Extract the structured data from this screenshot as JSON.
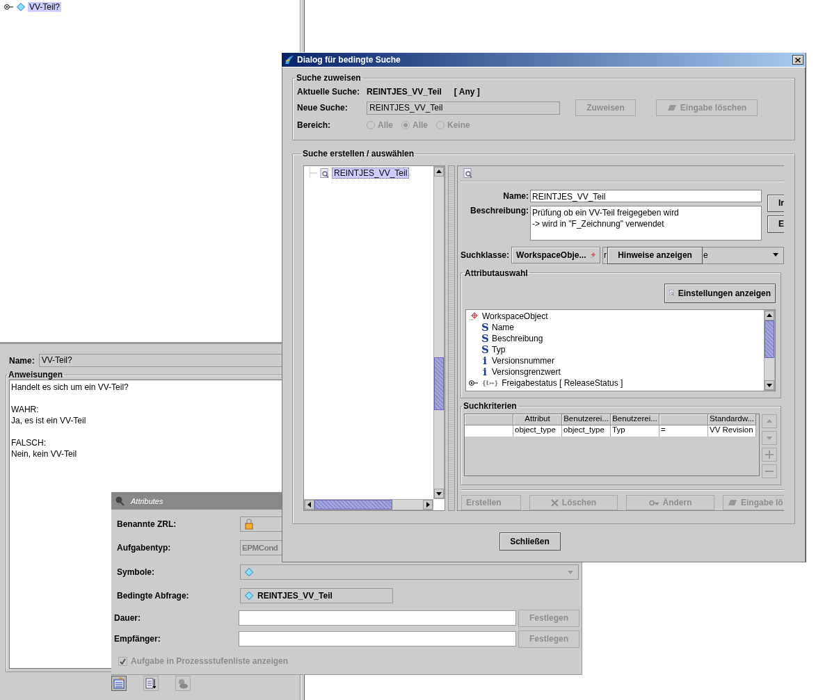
{
  "main_tree": {
    "items": [
      {
        "label": "VV-Teil?",
        "selected": true,
        "expanded": false
      }
    ]
  },
  "properties": {
    "name_label": "Name:",
    "name_value": "VV-Teil?",
    "instructions_title": "Anweisungen",
    "instructions_text": "Handelt es sich um ein VV-Teil?\n\nWAHR:\nJa, es ist ein VV-Teil\n\nFALSCH:\nNein, kein VV-Teil"
  },
  "attributes_window": {
    "title": "Attributes",
    "rows": [
      {
        "kind": "lock",
        "label": "Benannte ZRL:"
      },
      {
        "kind": "readonly",
        "label": "Aufgabentyp:",
        "value": "EPMCond"
      },
      {
        "kind": "combo",
        "label": "Symbole:"
      },
      {
        "kind": "query",
        "label": "Bedingte Abfrage:",
        "value": "REINTJES_VV_Teil"
      },
      {
        "kind": "input",
        "label": "Dauer:",
        "button": "Festlegen",
        "button_disabled": true
      },
      {
        "kind": "input",
        "label": "Empfänger:",
        "button": "Festlegen",
        "button_disabled": true
      }
    ],
    "checkbox": {
      "label": "Aufgabe in Prozessstufenliste anzeigen",
      "checked": true,
      "disabled": true
    }
  },
  "dialog": {
    "title": "Dialog für bedingte Suche",
    "assign_group": {
      "title": "Suche zuweisen",
      "current_label": "Aktuelle Suche:",
      "current_value": "REINTJES_VV_Teil",
      "current_scope": "[ Any ]",
      "new_label": "Neue Suche:",
      "new_value": "REINTJES_VV_Teil",
      "buttons": [
        {
          "kind": "plain",
          "label": "Zuweisen",
          "disabled": true
        },
        {
          "kind": "eraser",
          "label": "Eingabe löschen",
          "disabled": true
        }
      ],
      "scope_label": "Bereich:",
      "scope_options": [
        {
          "label": "Alle",
          "selected": false,
          "disabled": true
        },
        {
          "label": "Alle",
          "selected": true,
          "disabled": true
        },
        {
          "label": "Keine",
          "selected": false,
          "disabled": true
        }
      ]
    },
    "build_group": {
      "title": "Suche erstellen / auswählen",
      "search_tree": {
        "items": [
          {
            "label": "REINTJES_VV_Teil",
            "selected": true
          }
        ]
      },
      "editor": {
        "name_label": "Name:",
        "name_value": "REINTJES_VV_Teil",
        "description_label": "Beschreibung:",
        "description_value": "Prüfung ob ein VV-Teil freigegeben wird\n-> wird in \"F_Zeichnung\" verwendet",
        "side_buttons": [
          "Ir",
          "E"
        ],
        "class_label": "Suchklasse:",
        "class_value": "WorkspaceObje...",
        "class_dropdown_fragments": [
          "r",
          "e"
        ],
        "hints_button": "Hinweise anzeigen",
        "attribute_group": {
          "title": "Attributauswahl",
          "settings_button": "Einstellungen anzeigen",
          "tree": [
            {
              "kind": "class",
              "label": "WorkspaceObject",
              "children": [
                {
                  "kind": "attribute",
                  "glyph": "S",
                  "label": "Name"
                },
                {
                  "kind": "attribute",
                  "glyph": "S",
                  "label": "Beschreibung"
                },
                {
                  "kind": "attribute",
                  "glyph": "S",
                  "label": "Typ"
                },
                {
                  "kind": "attribute",
                  "glyph": "i",
                  "label": "Versionsnummer"
                },
                {
                  "kind": "attribute",
                  "glyph": "i",
                  "label": "Versionsgrenzwert"
                },
                {
                  "kind": "reference",
                  "glyph": "{t↔}",
                  "label": "Freigabestatus [ ReleaseStatus ]",
                  "expanded": false
                }
              ]
            }
          ]
        },
        "criteria_group": {
          "title": "Suchkriterien",
          "columns": [
            {
              "kind": "blank"
            },
            {
              "kind": "text",
              "label": "Attribut"
            },
            {
              "kind": "text",
              "label": "Benutzerei..."
            },
            {
              "kind": "text",
              "label": "Benutzerei..."
            },
            {
              "kind": "blank"
            },
            {
              "kind": "text",
              "label": "Standardw..."
            }
          ],
          "rows": [
            {
              "cells": [
                {
                  "kind": "blank"
                },
                {
                  "kind": "text",
                  "text": "object_type"
                },
                {
                  "kind": "text",
                  "text": "object_type"
                },
                {
                  "kind": "text",
                  "text": "Typ"
                },
                {
                  "kind": "text",
                  "text": "="
                },
                {
                  "kind": "text",
                  "text": "VV Revision"
                }
              ]
            }
          ]
        },
        "action_buttons": [
          {
            "kind": "plain",
            "label": "Erstellen",
            "disabled": true
          },
          {
            "kind": "delete",
            "label": "Löschen",
            "disabled": true
          },
          {
            "kind": "key",
            "label": "Ändern",
            "disabled": true
          },
          {
            "kind": "eraser",
            "label": "Eingabe lö",
            "disabled": true
          }
        ]
      }
    },
    "close_button": "Schließen"
  }
}
